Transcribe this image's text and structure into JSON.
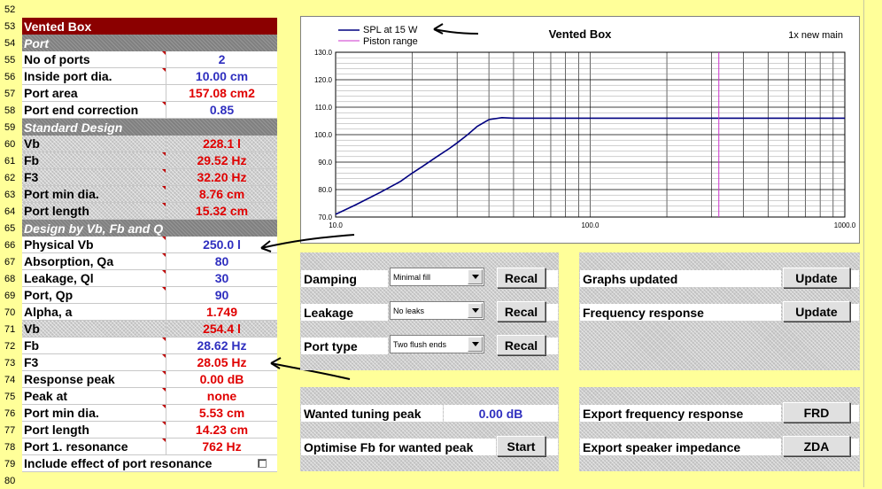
{
  "row_numbers": [
    "52",
    "53",
    "54",
    "55",
    "56",
    "57",
    "58",
    "59",
    "60",
    "61",
    "62",
    "63",
    "64",
    "65",
    "66",
    "67",
    "68",
    "69",
    "70",
    "71",
    "72",
    "73",
    "74",
    "75",
    "76",
    "77",
    "78",
    "79",
    "80"
  ],
  "title": "Vented Box",
  "sections": {
    "port": "Port",
    "standard": "Standard Design",
    "design": "Design by Vb, Fb and Q"
  },
  "rows": [
    {
      "label": "No of ports",
      "value": "2",
      "color": "blue"
    },
    {
      "label": "Inside port dia.",
      "value": "10.00 cm",
      "color": "blue"
    },
    {
      "label": "Port area",
      "value": "157.08 cm2",
      "color": "red"
    },
    {
      "label": "Port end correction",
      "value": "0.85",
      "color": "blue"
    },
    {
      "label": "Vb",
      "value": "228.1 l",
      "color": "red"
    },
    {
      "label": "Fb",
      "value": "29.52 Hz",
      "color": "red"
    },
    {
      "label": "F3",
      "value": "32.20 Hz",
      "color": "red"
    },
    {
      "label": "Port min dia.",
      "value": "8.76 cm",
      "color": "red"
    },
    {
      "label": "Port length",
      "value": "15.32 cm",
      "color": "red"
    },
    {
      "label": "Physical Vb",
      "value": "250.0 l",
      "color": "blue"
    },
    {
      "label": "Absorption, Qa",
      "value": "80",
      "color": "blue"
    },
    {
      "label": "Leakage, Ql",
      "value": "30",
      "color": "blue"
    },
    {
      "label": "Port, Qp",
      "value": "90",
      "color": "blue"
    },
    {
      "label": "Alpha, a",
      "value": "1.749",
      "color": "red"
    },
    {
      "label": "Vb",
      "value": "254.4 l",
      "color": "red"
    },
    {
      "label": "Fb",
      "value": "28.62 Hz",
      "color": "blue"
    },
    {
      "label": "F3",
      "value": "28.05 Hz",
      "color": "red"
    },
    {
      "label": "Response peak",
      "value": "0.00 dB",
      "color": "red"
    },
    {
      "label": "Peak at",
      "value": "none",
      "color": "red"
    },
    {
      "label": "Port min dia.",
      "value": "5.53 cm",
      "color": "red"
    },
    {
      "label": "Port length",
      "value": "14.23 cm",
      "color": "red"
    },
    {
      "label": "Port 1. resonance",
      "value": "762 Hz",
      "color": "red"
    }
  ],
  "include_port_resonance": {
    "label": "Include effect of port resonance",
    "checked": false
  },
  "chart_data": {
    "type": "line",
    "title": "Vented Box",
    "subtitle": "1x new main",
    "x_scale": "log",
    "xlim": [
      10,
      1000
    ],
    "ylim": [
      70,
      130
    ],
    "x_ticks": [
      "10.0",
      "100.0",
      "1000.0"
    ],
    "y_ticks": [
      "70.0",
      "80.0",
      "90.0",
      "100.0",
      "110.0",
      "120.0",
      "130.0"
    ],
    "grid": true,
    "legend_position": "top-left",
    "series": [
      {
        "name": "SPL at 15 W",
        "color": "#000080",
        "x": [
          10,
          12,
          15,
          18,
          20,
          22,
          25,
          28,
          30,
          33,
          36,
          40,
          45,
          50,
          100,
          200,
          500,
          1000
        ],
        "y": [
          71,
          74.5,
          79,
          83,
          86,
          88.5,
          92,
          95,
          97,
          100,
          103,
          105.5,
          106.2,
          106.0,
          106.0,
          106.0,
          106.0,
          106.0
        ]
      },
      {
        "name": "Piston range",
        "color": "#cc33cc",
        "vertical_at": 320
      }
    ]
  },
  "controls": {
    "damping": {
      "label": "Damping",
      "value": "Minimal fill",
      "button": "Recal"
    },
    "leakage": {
      "label": "Leakage",
      "value": "No leaks",
      "button": "Recal"
    },
    "port_type": {
      "label": "Port type",
      "value": "Two flush ends",
      "button": "Recal"
    },
    "graphs_updated": {
      "label": "Graphs updated",
      "button": "Update"
    },
    "frequency_response": {
      "label": "Frequency response",
      "button": "Update"
    },
    "wanted_peak": {
      "label": "Wanted tuning peak",
      "value": "0.00 dB"
    },
    "optimise": {
      "label": "Optimise Fb for wanted peak",
      "button": "Start"
    },
    "export_frd": {
      "label": "Export frequency response",
      "button": "FRD"
    },
    "export_zda": {
      "label": "Export speaker impedance",
      "button": "ZDA"
    }
  },
  "colors": {
    "sheet": "#ffff99",
    "title_bg": "#8b0000",
    "value_blue": "#2f2fbf",
    "value_red": "#e00000"
  }
}
